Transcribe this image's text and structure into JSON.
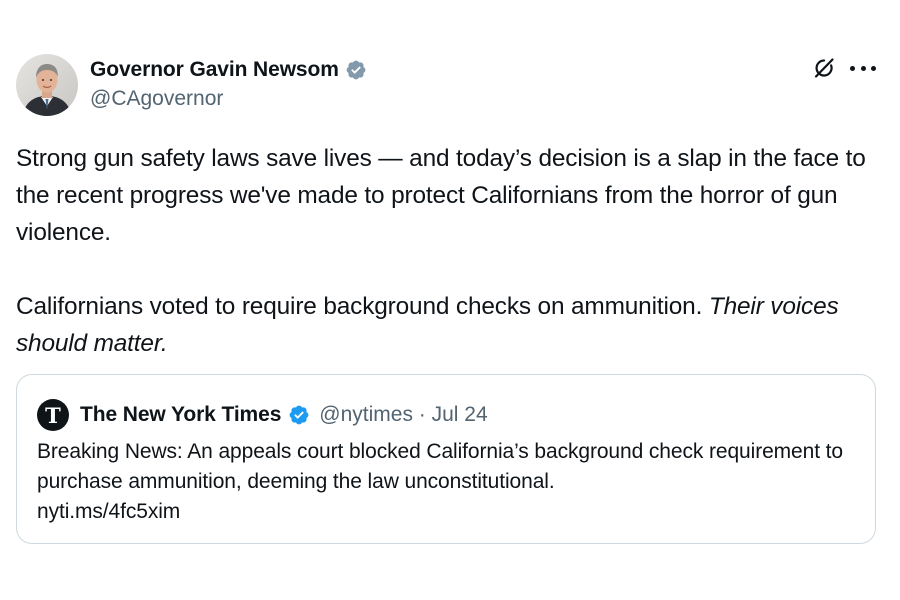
{
  "tweet": {
    "author": {
      "display_name": "Governor Gavin Newsom",
      "handle": "@CAgovernor",
      "verified": "gray-checkmark-badge"
    },
    "header_icons": [
      "grok-icon",
      "more-options-icon"
    ],
    "paragraph_1": "Strong gun safety laws save lives — and today’s decision is a slap in the face to the recent progress we've made to protect Californians from the horror of gun violence.",
    "paragraph_2_plain": "Californians voted to require background checks on ammunition. ",
    "paragraph_2_italic": "Their voices should matter."
  },
  "quote": {
    "display_name": "The New York Times",
    "verified": "blue-checkmark-badge",
    "handle_date": "@nytimes · Jul 24",
    "text": "Breaking News: An appeals court blocked California’s background check requirement to purchase ammunition, deeming the law unconstitutional.",
    "link": "nyti.ms/4fc5xim"
  },
  "colors": {
    "text": "#0f1419",
    "secondary_text": "#536471",
    "border": "#cfd9de",
    "verified_blue": "#1d9bf0",
    "verified_gray": "#829aab"
  }
}
